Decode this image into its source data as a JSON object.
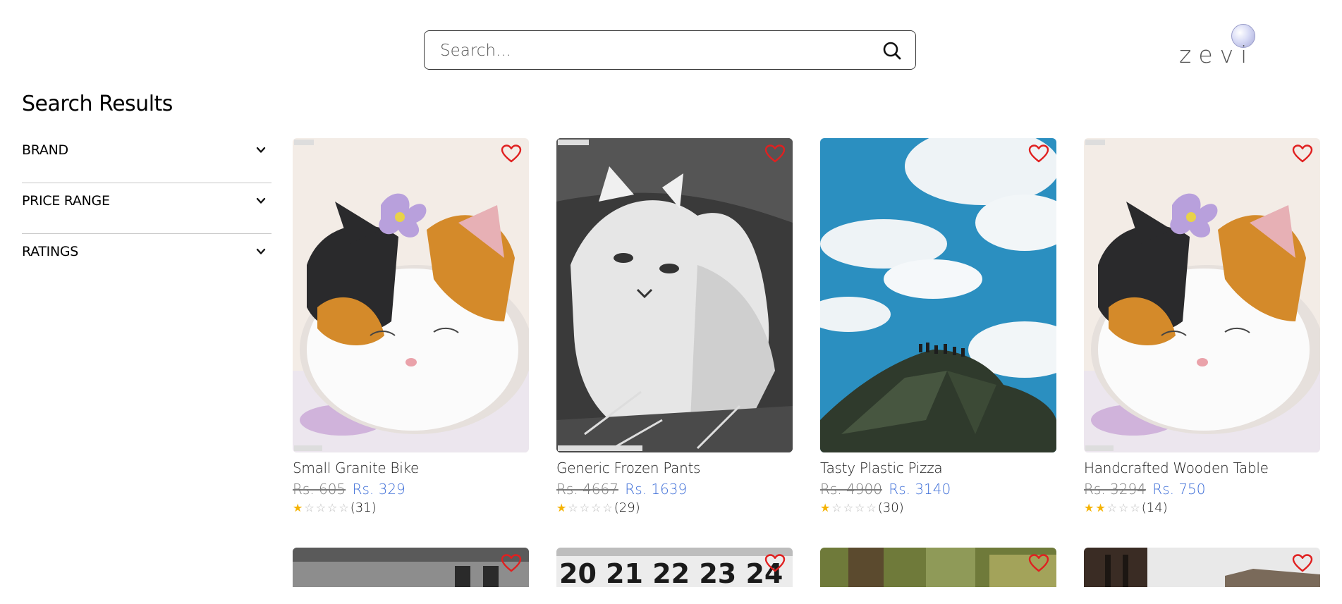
{
  "header": {
    "search": {
      "placeholder": "Search...",
      "value": ""
    },
    "logo_text": "zevi"
  },
  "page_title": "Search Results",
  "filters": [
    {
      "label": "BRAND"
    },
    {
      "label": "PRICE RANGE"
    },
    {
      "label": "RATINGS"
    }
  ],
  "currency_prefix": "Rs.",
  "products": [
    {
      "name": "Small Granite Bike",
      "old_price": "Rs. 605",
      "new_price": "Rs. 329",
      "rating": 1,
      "reviews": "(31)",
      "image": "felt-calico-kitten"
    },
    {
      "name": "Generic Frozen Pants",
      "old_price": "Rs. 4667",
      "new_price": "Rs. 1639",
      "rating": 1,
      "reviews": "(29)",
      "image": "sketch-kitten"
    },
    {
      "name": "Tasty Plastic Pizza",
      "old_price": "Rs. 4900",
      "new_price": "Rs. 3140",
      "rating": 1,
      "reviews": "(30)",
      "image": "mountain-sky"
    },
    {
      "name": "Handcrafted Wooden Table",
      "old_price": "Rs. 3294",
      "new_price": "Rs. 750",
      "rating": 2,
      "reviews": "(14)",
      "image": "felt-calico-kitten"
    }
  ],
  "row2_images": [
    "grey-building",
    "calendar-numbers",
    "green-street",
    "brick-rooftops"
  ],
  "calendar_numbers": "20 21 22 23 24",
  "colors": {
    "accent": "#3f6fd8",
    "star": "#f5b301",
    "heart": "#e02020"
  }
}
